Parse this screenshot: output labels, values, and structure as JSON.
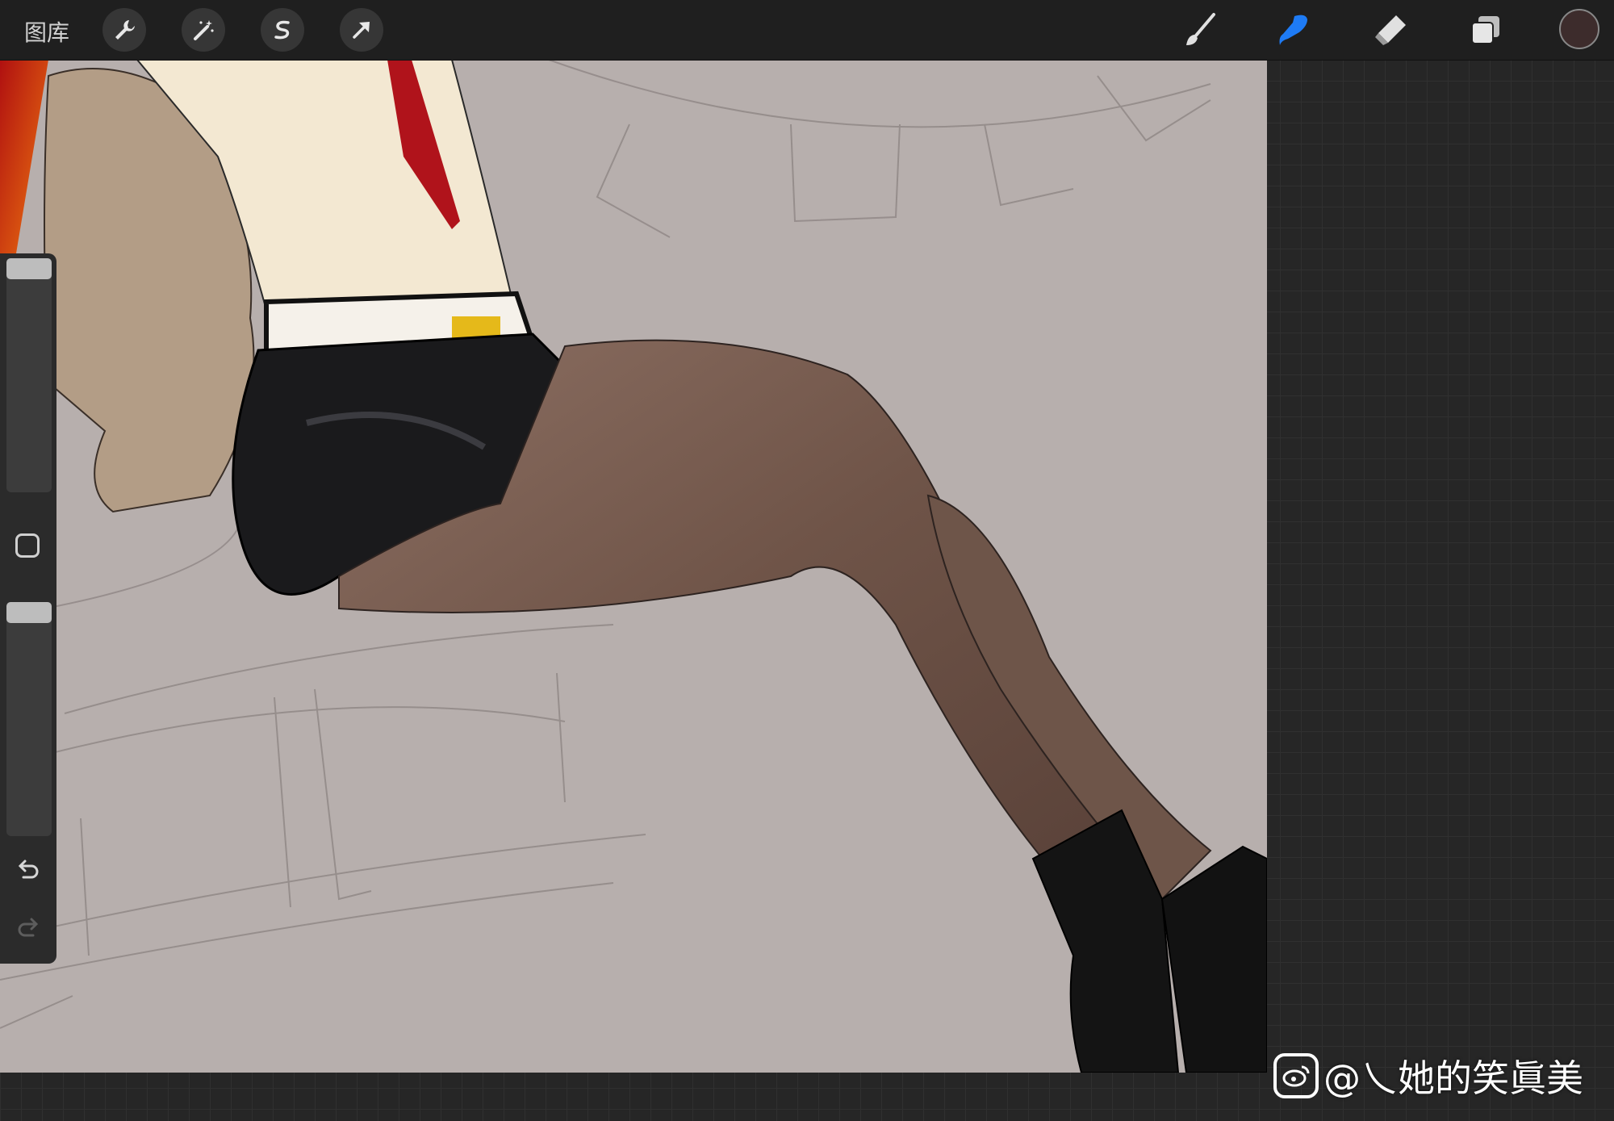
{
  "toolbar": {
    "gallery_label": "图库",
    "actions": [
      "wrench-icon",
      "magic-wand-icon",
      "selection-s-icon",
      "transform-arrow-icon"
    ],
    "tools": [
      "brush-icon",
      "smudge-icon",
      "eraser-icon",
      "layers-icon"
    ],
    "active_tool": "smudge",
    "accent_color": "#1e7bf5",
    "current_color": "#3d2c2c"
  },
  "sidebar": {
    "brush_size_level": 0.0,
    "opacity_level": 0.0,
    "controls": [
      "brush-size-slider",
      "modify-square-button",
      "opacity-slider",
      "undo-icon",
      "redo-icon"
    ]
  },
  "canvas": {
    "background_color": "#b7afad"
  },
  "watermark": {
    "text": "@乀她的笑眞美"
  }
}
